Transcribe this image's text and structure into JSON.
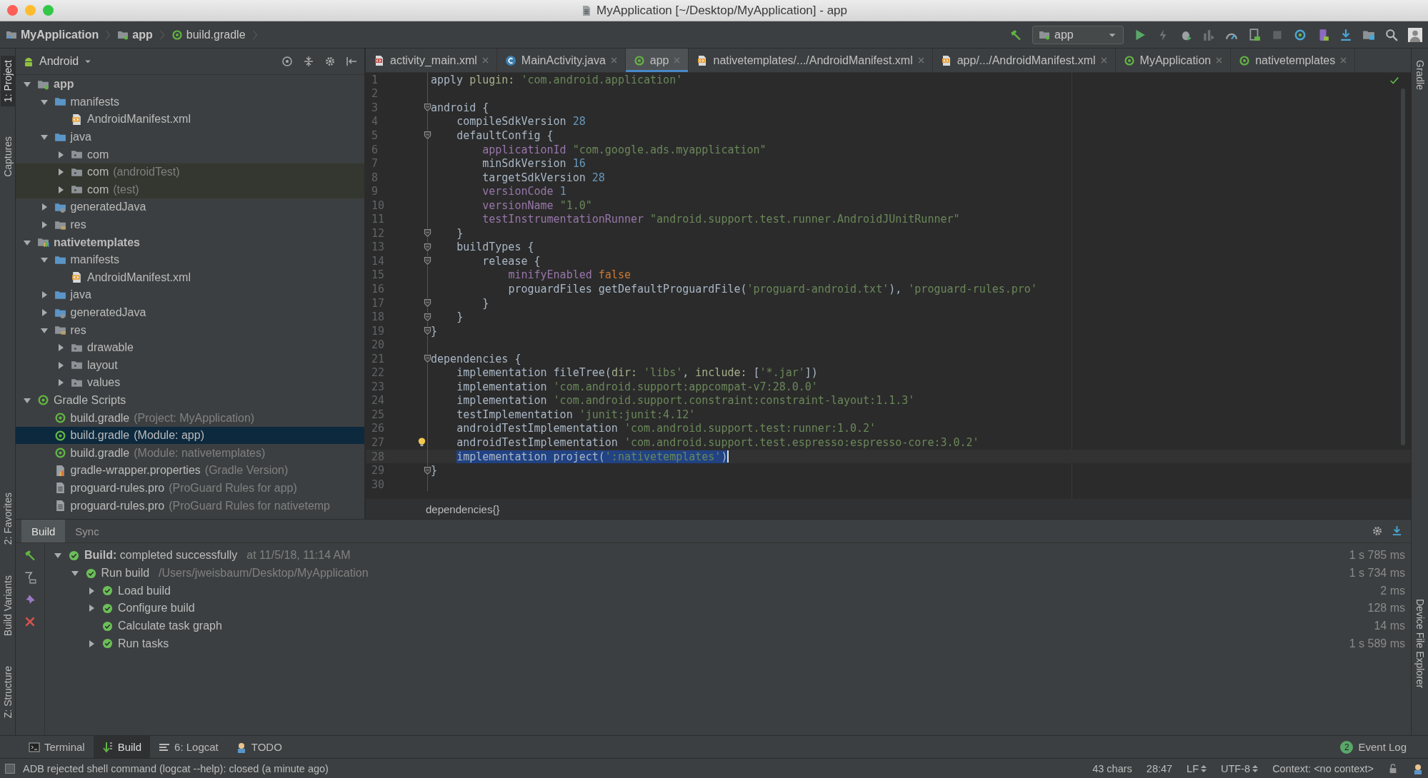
{
  "window": {
    "title": "MyApplication [~/Desktop/MyApplication] - app"
  },
  "breadcrumb": [
    {
      "label": "MyApplication",
      "kind": "project"
    },
    {
      "label": "app",
      "kind": "module"
    },
    {
      "label": "build.gradle",
      "kind": "gradle"
    }
  ],
  "run_config": {
    "label": "app"
  },
  "left_stripe": [
    {
      "label": "1: Project",
      "selected": true
    },
    {
      "label": "Captures",
      "selected": false
    },
    {
      "label": "2: Favorites",
      "selected": false
    },
    {
      "label": "Build Variants",
      "selected": false
    },
    {
      "label": "Z: Structure",
      "selected": false
    }
  ],
  "right_stripe": [
    {
      "label": "Gradle"
    },
    {
      "label": "Device File Explorer"
    }
  ],
  "project_panel": {
    "view": "Android",
    "tree": [
      {
        "label": "app",
        "kind": "module",
        "expanded": true,
        "selected": false,
        "tinted": false,
        "children": [
          {
            "label": "manifests",
            "kind": "folder",
            "expanded": true,
            "selected": false,
            "tinted": false,
            "children": [
              {
                "label": "AndroidManifest.xml",
                "kind": "manifest",
                "selected": false,
                "tinted": false
              }
            ]
          },
          {
            "label": "java",
            "kind": "folder",
            "expanded": true,
            "selected": false,
            "tinted": false,
            "children": [
              {
                "label": "com",
                "kind": "package",
                "expanded": false,
                "selected": false,
                "tinted": false
              },
              {
                "label": "com",
                "note": "(androidTest)",
                "kind": "package",
                "expanded": false,
                "selected": false,
                "tinted": true
              },
              {
                "label": "com",
                "note": "(test)",
                "kind": "package",
                "expanded": false,
                "selected": false,
                "tinted": true
              }
            ]
          },
          {
            "label": "generatedJava",
            "kind": "gen-folder",
            "expanded": false,
            "selected": false,
            "tinted": false
          },
          {
            "label": "res",
            "kind": "res-folder",
            "expanded": false,
            "selected": false,
            "tinted": false
          }
        ]
      },
      {
        "label": "nativetemplates",
        "kind": "lib-module",
        "expanded": true,
        "selected": false,
        "tinted": false,
        "children": [
          {
            "label": "manifests",
            "kind": "folder",
            "expanded": true,
            "selected": false,
            "tinted": false,
            "children": [
              {
                "label": "AndroidManifest.xml",
                "kind": "manifest",
                "selected": false,
                "tinted": false
              }
            ]
          },
          {
            "label": "java",
            "kind": "folder",
            "expanded": false,
            "selected": false,
            "tinted": false
          },
          {
            "label": "generatedJava",
            "kind": "gen-folder",
            "expanded": false,
            "selected": false,
            "tinted": false
          },
          {
            "label": "res",
            "kind": "res-folder",
            "expanded": true,
            "selected": false,
            "tinted": false,
            "children": [
              {
                "label": "drawable",
                "kind": "package",
                "expanded": false,
                "selected": false,
                "tinted": false
              },
              {
                "label": "layout",
                "kind": "package",
                "expanded": false,
                "selected": false,
                "tinted": false
              },
              {
                "label": "values",
                "kind": "package",
                "expanded": false,
                "selected": false,
                "tinted": false
              }
            ]
          }
        ]
      },
      {
        "label": "Gradle Scripts",
        "kind": "gradle",
        "expanded": true,
        "selected": false,
        "tinted": false,
        "children": [
          {
            "label": "build.gradle",
            "note": "(Project: MyApplication)",
            "kind": "gradle",
            "selected": false,
            "tinted": false
          },
          {
            "label": "build.gradle",
            "note": "(Module: app)",
            "kind": "gradle",
            "selected": true,
            "tinted": false
          },
          {
            "label": "build.gradle",
            "note": "(Module: nativetemplates)",
            "kind": "gradle",
            "selected": false,
            "tinted": false
          },
          {
            "label": "gradle-wrapper.properties",
            "note": "(Gradle Version)",
            "kind": "props",
            "selected": false,
            "tinted": false
          },
          {
            "label": "proguard-rules.pro",
            "note": "(ProGuard Rules for app)",
            "kind": "file",
            "selected": false,
            "tinted": false
          },
          {
            "label": "proguard-rules.pro",
            "note": "(ProGuard Rules for nativetemp",
            "kind": "file",
            "selected": false,
            "tinted": false
          }
        ]
      }
    ]
  },
  "editor": {
    "tabs": [
      {
        "label": "activity_main.xml",
        "kind": "xml",
        "selected": false
      },
      {
        "label": "MainActivity.java",
        "kind": "class",
        "selected": false
      },
      {
        "label": "app",
        "kind": "gradle",
        "selected": true
      },
      {
        "label": "nativetemplates/.../AndroidManifest.xml",
        "kind": "manifest",
        "selected": false
      },
      {
        "label": "app/.../AndroidManifest.xml",
        "kind": "manifest",
        "selected": false
      },
      {
        "label": "MyApplication",
        "kind": "gradle",
        "selected": false
      },
      {
        "label": "nativetemplates",
        "kind": "gradle",
        "selected": false
      }
    ],
    "lines": [
      {
        "n": "1",
        "fold": false,
        "hint": false,
        "selected": false,
        "tokens": [
          {
            "kind": "t",
            "text": "apply "
          },
          {
            "kind": "a",
            "text": "plugin: "
          },
          {
            "kind": "s",
            "text": "'com.android.application'"
          }
        ]
      },
      {
        "n": "2",
        "fold": false,
        "hint": false,
        "selected": false
      },
      {
        "n": "3",
        "fold": true,
        "hint": false,
        "selected": false,
        "tokens": [
          {
            "kind": "t",
            "text": "android {"
          }
        ]
      },
      {
        "n": "4",
        "fold": false,
        "hint": false,
        "selected": false,
        "tokens": [
          {
            "kind": "t",
            "text": "    compileSdkVersion "
          },
          {
            "kind": "n",
            "text": "28"
          }
        ]
      },
      {
        "n": "5",
        "fold": true,
        "hint": false,
        "selected": false,
        "tokens": [
          {
            "kind": "t",
            "text": "    defaultConfig {"
          }
        ]
      },
      {
        "n": "6",
        "fold": false,
        "hint": false,
        "selected": false,
        "tokens": [
          {
            "kind": "p",
            "text": "        applicationId "
          },
          {
            "kind": "s",
            "text": "\"com.google.ads.myapplication\""
          }
        ]
      },
      {
        "n": "7",
        "fold": false,
        "hint": false,
        "selected": false,
        "tokens": [
          {
            "kind": "t",
            "text": "        minSdkVersion "
          },
          {
            "kind": "n",
            "text": "16"
          }
        ]
      },
      {
        "n": "8",
        "fold": false,
        "hint": false,
        "selected": false,
        "tokens": [
          {
            "kind": "t",
            "text": "        targetSdkVersion "
          },
          {
            "kind": "n",
            "text": "28"
          }
        ]
      },
      {
        "n": "9",
        "fold": false,
        "hint": false,
        "selected": false,
        "tokens": [
          {
            "kind": "p",
            "text": "        versionCode "
          },
          {
            "kind": "n",
            "text": "1"
          }
        ]
      },
      {
        "n": "10",
        "fold": false,
        "hint": false,
        "selected": false,
        "tokens": [
          {
            "kind": "p",
            "text": "        versionName "
          },
          {
            "kind": "s",
            "text": "\"1.0\""
          }
        ]
      },
      {
        "n": "11",
        "fold": false,
        "hint": false,
        "selected": false,
        "tokens": [
          {
            "kind": "p",
            "text": "        testInstrumentationRunner "
          },
          {
            "kind": "s",
            "text": "\"android.support.test.runner.AndroidJUnitRunner\""
          }
        ]
      },
      {
        "n": "12",
        "fold": true,
        "hint": false,
        "selected": false,
        "tokens": [
          {
            "kind": "t",
            "text": "    }"
          }
        ]
      },
      {
        "n": "13",
        "fold": true,
        "hint": false,
        "selected": false,
        "tokens": [
          {
            "kind": "t",
            "text": "    buildTypes {"
          }
        ]
      },
      {
        "n": "14",
        "fold": true,
        "hint": false,
        "selected": false,
        "tokens": [
          {
            "kind": "t",
            "text": "        release {"
          }
        ]
      },
      {
        "n": "15",
        "fold": false,
        "hint": false,
        "selected": false,
        "tokens": [
          {
            "kind": "p",
            "text": "            minifyEnabled "
          },
          {
            "kind": "k",
            "text": "false"
          }
        ]
      },
      {
        "n": "16",
        "fold": false,
        "hint": false,
        "selected": false,
        "tokens": [
          {
            "kind": "t",
            "text": "            proguardFiles getDefaultProguardFile("
          },
          {
            "kind": "s",
            "text": "'proguard-android.txt'"
          },
          {
            "kind": "t",
            "text": "), "
          },
          {
            "kind": "s",
            "text": "'proguard-rules.pro'"
          }
        ]
      },
      {
        "n": "17",
        "fold": true,
        "hint": false,
        "selected": false,
        "tokens": [
          {
            "kind": "t",
            "text": "        }"
          }
        ]
      },
      {
        "n": "18",
        "fold": true,
        "hint": false,
        "selected": false,
        "tokens": [
          {
            "kind": "t",
            "text": "    }"
          }
        ]
      },
      {
        "n": "19",
        "fold": true,
        "hint": false,
        "selected": false,
        "tokens": [
          {
            "kind": "t",
            "text": "}"
          }
        ]
      },
      {
        "n": "20",
        "fold": false,
        "hint": false,
        "selected": false
      },
      {
        "n": "21",
        "fold": true,
        "hint": false,
        "selected": false,
        "tokens": [
          {
            "kind": "t",
            "text": "dependencies {"
          }
        ]
      },
      {
        "n": "22",
        "fold": false,
        "hint": false,
        "selected": false,
        "tokens": [
          {
            "kind": "t",
            "text": "    implementation fileTree("
          },
          {
            "kind": "a",
            "text": "dir: "
          },
          {
            "kind": "s",
            "text": "'libs'"
          },
          {
            "kind": "t",
            "text": ", "
          },
          {
            "kind": "a",
            "text": "include: "
          },
          {
            "kind": "t",
            "text": "["
          },
          {
            "kind": "s",
            "text": "'*.jar'"
          },
          {
            "kind": "t",
            "text": "])"
          }
        ]
      },
      {
        "n": "23",
        "fold": false,
        "hint": false,
        "selected": false,
        "tokens": [
          {
            "kind": "t",
            "text": "    implementation "
          },
          {
            "kind": "s",
            "text": "'com.android.support:appcompat-v7:28.0.0'"
          }
        ]
      },
      {
        "n": "24",
        "fold": false,
        "hint": false,
        "selected": false,
        "tokens": [
          {
            "kind": "t",
            "text": "    implementation "
          },
          {
            "kind": "s",
            "text": "'com.android.support.constraint:constraint-layout:1.1.3'"
          }
        ]
      },
      {
        "n": "25",
        "fold": false,
        "hint": false,
        "selected": false,
        "tokens": [
          {
            "kind": "t",
            "text": "    testImplementation "
          },
          {
            "kind": "s",
            "text": "'junit:junit:4.12'"
          }
        ]
      },
      {
        "n": "26",
        "fold": false,
        "hint": false,
        "selected": false,
        "tokens": [
          {
            "kind": "t",
            "text": "    androidTestImplementation "
          },
          {
            "kind": "s",
            "text": "'com.android.support.test:runner:1.0.2'"
          }
        ]
      },
      {
        "n": "27",
        "fold": false,
        "hint": true,
        "selected": false,
        "tokens": [
          {
            "kind": "t",
            "text": "    androidTestImplementation "
          },
          {
            "kind": "s",
            "text": "'com.android.support.test.espresso:espresso-core:3.0.2'"
          }
        ]
      },
      {
        "n": "28",
        "fold": false,
        "hint": false,
        "selected": true,
        "tokens": [
          {
            "kind": "t",
            "text": "    implementation project("
          },
          {
            "kind": "s",
            "text": "':nativetemplates'"
          },
          {
            "kind": "t",
            "text": ")"
          }
        ]
      },
      {
        "n": "29",
        "fold": true,
        "hint": false,
        "selected": false,
        "tokens": [
          {
            "kind": "t",
            "text": "}"
          }
        ]
      },
      {
        "n": "30",
        "fold": false,
        "hint": false,
        "selected": false
      }
    ],
    "breadcrumb": "dependencies{}"
  },
  "build_panel": {
    "tabs": [
      {
        "label": "Build",
        "selected": true
      },
      {
        "label": "Sync",
        "selected": false
      }
    ],
    "tree": [
      {
        "label": "**Build:** completed successfully",
        "note": "at 11/5/18, 11:14 AM",
        "time": "1 s 785 ms",
        "expanded": true,
        "children": [
          {
            "label": "Run build",
            "note": "/Users/jweisbaum/Desktop/MyApplication",
            "time": "1 s 734 ms",
            "expanded": true,
            "children": [
              {
                "label": "Load build",
                "time": "2 ms",
                "expanded": false
              },
              {
                "label": "Configure build",
                "time": "128 ms",
                "expanded": false
              },
              {
                "label": "Calculate task graph",
                "time": "14 ms"
              },
              {
                "label": "Run tasks",
                "time": "1 s 589 ms",
                "expanded": false
              }
            ]
          }
        ]
      }
    ]
  },
  "tool_tabs": [
    {
      "label": "Terminal",
      "kind": "terminal",
      "selected": false
    },
    {
      "label": "Build",
      "kind": "build",
      "selected": true
    },
    {
      "label": "6: Logcat",
      "kind": "logcat",
      "selected": false
    },
    {
      "label": "TODO",
      "kind": "todo",
      "selected": false
    }
  ],
  "event_log": {
    "label": "Event Log",
    "count": "2"
  },
  "status_bar": {
    "message": "ADB rejected shell command (logcat --help): closed (a minute ago)",
    "items": [
      {
        "label": "43 chars",
        "kind": "plain"
      },
      {
        "label": "28:47",
        "kind": "plain"
      },
      {
        "label": "LF",
        "kind": "menu"
      },
      {
        "label": "UTF-8",
        "kind": "menu"
      },
      {
        "label": "Context: <no context>",
        "kind": "plain"
      }
    ]
  }
}
